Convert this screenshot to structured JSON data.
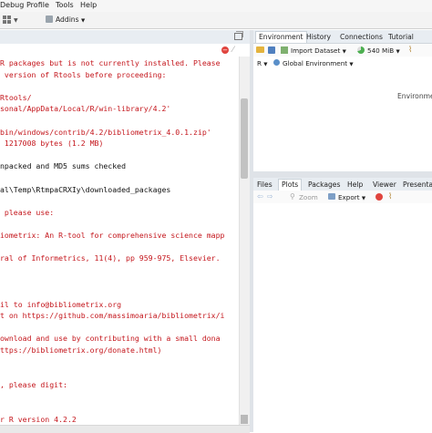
{
  "menubar": {
    "items": [
      "Debug",
      "Profile",
      "Tools",
      "Help"
    ]
  },
  "toolbar": {
    "addins_label": "Addins"
  },
  "console": {
    "lines": [
      {
        "text": "R packages but is not currently installed. Please",
        "color": "red"
      },
      {
        "text": " version of Rtools before proceeding:",
        "color": "red"
      },
      {
        "text": "",
        "color": "red"
      },
      {
        "text": "Rtools/",
        "color": "red"
      },
      {
        "text": "sonal/AppData/Local/R/win-library/4.2'",
        "color": "red"
      },
      {
        "text": "",
        "color": "red"
      },
      {
        "text": "bin/windows/contrib/4.2/bibliometrix_4.0.1.zip'",
        "color": "red"
      },
      {
        "text": " 1217008 bytes (1.2 MB)",
        "color": "red"
      },
      {
        "text": "",
        "color": "red"
      },
      {
        "text": "npacked and MD5 sums checked",
        "color": "black"
      },
      {
        "text": "",
        "color": "black"
      },
      {
        "text": "al\\Temp\\RtmpaCRXIy\\downloaded_packages",
        "color": "black"
      },
      {
        "text": "",
        "color": "black"
      },
      {
        "text": " please use:",
        "color": "red"
      },
      {
        "text": "",
        "color": "red"
      },
      {
        "text": "iometrix: An R-tool for comprehensive science mapp",
        "color": "red"
      },
      {
        "text": "",
        "color": "red"
      },
      {
        "text": "ral of Informetrics, 11(4), pp 959-975, Elsevier.",
        "color": "red"
      },
      {
        "text": "",
        "color": "red"
      },
      {
        "text": "",
        "color": "red"
      },
      {
        "text": "",
        "color": "red"
      },
      {
        "text": "il to info@bibliometrix.org",
        "color": "red"
      },
      {
        "text": "t on https://github.com/massimoaria/bibliometrix/i",
        "color": "red"
      },
      {
        "text": "",
        "color": "red"
      },
      {
        "text": "ownload and use by contributing with a small dona",
        "color": "red"
      },
      {
        "text": "ttps://bibliometrix.org/donate.html)",
        "color": "red"
      },
      {
        "text": "",
        "color": "red"
      },
      {
        "text": "",
        "color": "red"
      },
      {
        "text": ", please digit:",
        "color": "red"
      },
      {
        "text": "",
        "color": "red"
      },
      {
        "text": "",
        "color": "red"
      },
      {
        "text": "r R version 4.2.2",
        "color": "red"
      }
    ]
  },
  "env_pane": {
    "tabs": [
      "Environment",
      "History",
      "Connections",
      "Tutorial"
    ],
    "active_tab": "Environment",
    "import_label": "Import Dataset",
    "memory_label": "540 MiB",
    "scope_lang": "R",
    "scope_label": "Global Environment",
    "body_text": "Environme"
  },
  "files_pane": {
    "tabs": [
      "Files",
      "Plots",
      "Packages",
      "Help",
      "Viewer",
      "Presentat"
    ],
    "active_tab": "Plots",
    "zoom_label": "Zoom",
    "export_label": "Export"
  },
  "colors": {
    "console_error": "#c4161c",
    "pane_header": "#e8edf2",
    "close_red": "#e0443e"
  }
}
